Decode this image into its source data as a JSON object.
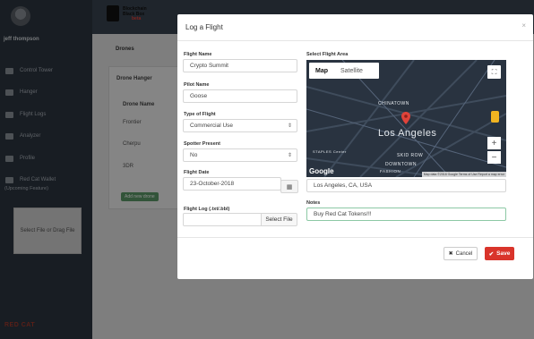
{
  "sidebar": {
    "username": "jeff thompson",
    "items": [
      {
        "label": "Control Tower",
        "icon": "control-tower-icon"
      },
      {
        "label": "Hanger",
        "icon": "hanger-icon"
      },
      {
        "label": "Flight Logs",
        "icon": "folder-icon"
      },
      {
        "label": "Analyzer",
        "icon": "analyzer-icon"
      },
      {
        "label": "Profile",
        "icon": "profile-icon"
      },
      {
        "label": "Red Cat Wallet",
        "icon": "wallet-icon"
      }
    ],
    "wallet_note": "(Upcoming Feature)",
    "dropzone": "Select File or Drag File",
    "brand": "RED CAT"
  },
  "topbar": {
    "logo_text_1": "Blockchain",
    "logo_text_2": "Black Box",
    "logo_beta": "beta"
  },
  "background": {
    "tab": "Drones",
    "panel_title": "Drone Hanger",
    "column": "Drone Name",
    "drones": [
      "Frontier",
      "Cherpu",
      "3DR"
    ],
    "add_button": "Add new drone"
  },
  "modal": {
    "title": "Log a Flight",
    "close": "×",
    "flight_name_label": "Flight Name",
    "flight_name": "Crypto Summit",
    "pilot_name_label": "Pilot Name",
    "pilot_name": "Goose",
    "type_label": "Type of Flight",
    "type_value": "Commercial Use",
    "spotter_label": "Spotter Present",
    "spotter_value": "No",
    "date_label": "Flight Date",
    "date_value": "23-October-2018",
    "log_label": "Flight Log (.txt/.bbl)",
    "log_value": "",
    "select_file": "Select File",
    "area_label": "Select Flight Area",
    "map_tab_map": "Map",
    "map_tab_satellite": "Satellite",
    "map_city": "Los Angeles",
    "map_chinatown": "CHINATOWN",
    "map_skid_row": "SKID ROW",
    "map_downtown": "DOWNTOWN",
    "map_fashion": "FASHION",
    "map_staples": "STAPLES Center",
    "map_attr": "Map data ©2018 Google   Terms of Use   Report a map error",
    "map_google": "Google",
    "location": "Los Angeles, CA, USA",
    "notes_label": "Notes",
    "notes": "Buy Red Cat Tokens!!!",
    "cancel": "Cancel",
    "save": "Save"
  },
  "colors": {
    "sidebar_bg": "#2c3540",
    "save": "#d9342b",
    "notes_border": "#8cc9a5",
    "map_pin": "#e0433a"
  }
}
